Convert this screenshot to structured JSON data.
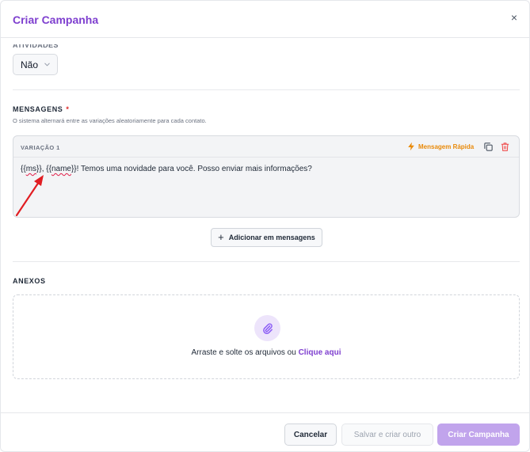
{
  "modal": {
    "title": "Criar Campanha",
    "close_icon": "×"
  },
  "options_section": {
    "clipped_label": "ATIVIDADES",
    "select_value": "Não"
  },
  "messages": {
    "title": "MENSAGENS",
    "required_marker": "*",
    "helper": "O sistema alternará entre as variações aleatoriamente para cada contato.",
    "variation": {
      "label": "VARIAÇÃO 1",
      "quick_label": "Mensagem Rápida",
      "text_parts": [
        "{{",
        "ms",
        "}}, {{",
        "name",
        "}}! Temos uma novidade para você. Posso enviar mais informações?"
      ]
    },
    "add_label": "Adicionar em mensagens"
  },
  "attachments": {
    "title": "ANEXOS",
    "drop_text": "Arraste e solte os arquivos ou",
    "drop_link": "Clique aqui"
  },
  "footer": {
    "cancel": "Cancelar",
    "save_and_create": "Salvar e criar outro",
    "create": "Criar Campanha"
  },
  "colors": {
    "accent": "#7e3fcf",
    "accent_disabled": "#c1a4ec",
    "quick_action": "#e98a0a",
    "delete": "#ef4444",
    "required": "#dc2626",
    "annotation_arrow": "#e11d22"
  }
}
